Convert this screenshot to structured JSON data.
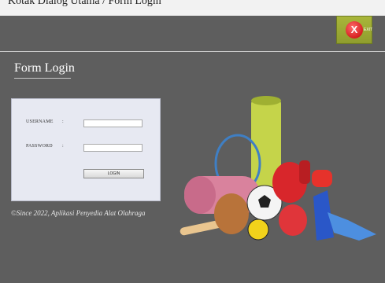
{
  "header": {
    "caption": "Kotak Dialog Utama / Form Login",
    "exit_label": "EXIT",
    "exit_symbol": "X"
  },
  "form": {
    "title": "Form Login",
    "username_label": "USERNAME",
    "password_label": "PASSWORD",
    "colon": ":",
    "username_value": "",
    "password_value": "",
    "login_label": "LOGIN"
  },
  "footer": {
    "copyright": "©Since 2022, Aplikasi Penyedia Alat Olahraga"
  },
  "colors": {
    "background": "#5e5e5e",
    "panel": "#e7e9f2",
    "exit_button": "#99a632",
    "exit_icon": "#d40000"
  }
}
